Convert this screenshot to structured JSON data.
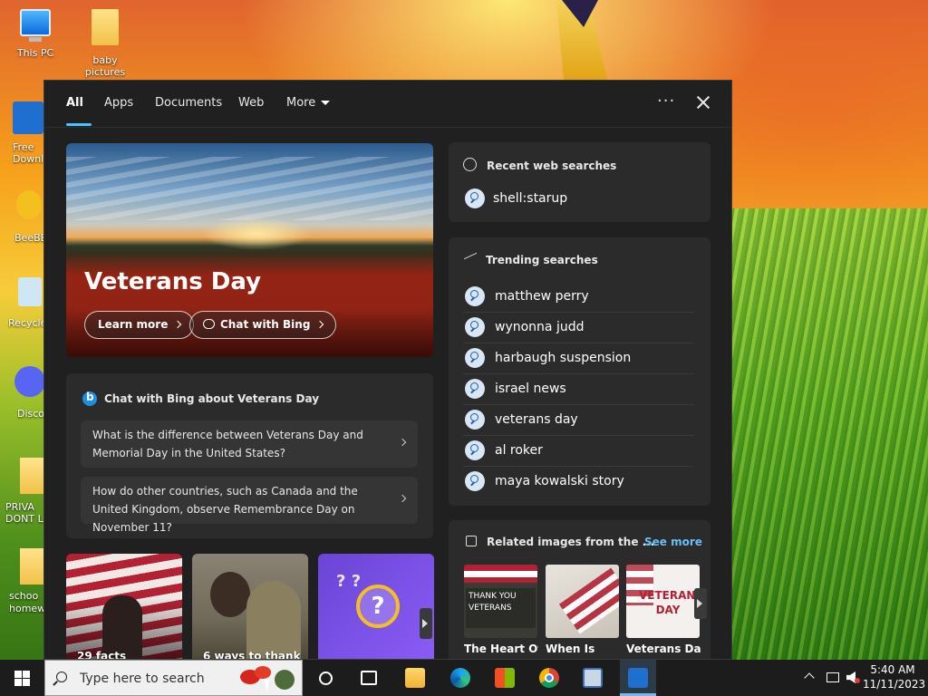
{
  "desktop": {
    "icons": [
      {
        "label": "This PC"
      },
      {
        "label": "baby pictures"
      },
      {
        "label": "Free Downl"
      },
      {
        "label": "BeeBE"
      },
      {
        "label": "Recycle"
      },
      {
        "label": "Disco"
      },
      {
        "label": "PRIVA DONT L"
      },
      {
        "label": "schoo homew"
      }
    ]
  },
  "search_panel": {
    "tabs": [
      {
        "label": "All",
        "active": true
      },
      {
        "label": "Apps"
      },
      {
        "label": "Documents"
      },
      {
        "label": "Web"
      },
      {
        "label": "More"
      }
    ],
    "more_icon": "ellipsis-icon",
    "close_icon": "close-icon",
    "hero": {
      "title": "Veterans Day",
      "learn_more": "Learn more",
      "chat_with_bing": "Chat with Bing"
    },
    "bing_chat": {
      "heading": "Chat with Bing about Veterans Day",
      "questions": [
        "What is the difference between Veterans Day and Memorial Day in the United States?",
        "How do other countries, such as Canada and the United Kingdom, observe Remembrance Day on November 11?"
      ]
    },
    "thumbnails": [
      {
        "label": "29 facts"
      },
      {
        "label": "6 ways to thank"
      },
      {
        "label": ""
      }
    ],
    "recent": {
      "heading": "Recent web searches",
      "items": [
        "shell:starup"
      ]
    },
    "trending": {
      "heading": "Trending searches",
      "items": [
        "matthew perry",
        "wynonna judd",
        "harbaugh suspension",
        "israel news",
        "veterans day",
        "al roker",
        "maya kowalski story"
      ]
    },
    "related": {
      "heading": "Related images from the ...",
      "see_more": "See more",
      "images": [
        {
          "label": "The Heart Of",
          "text": "THANK YOU VETERANS"
        },
        {
          "label": "When Is",
          "text": ""
        },
        {
          "label": "Veterans Day",
          "text": "VETERANS DAY"
        }
      ]
    }
  },
  "taskbar": {
    "search_placeholder": "Type here to search",
    "apps": [
      "file-explorer-icon",
      "edge-icon",
      "store-icon",
      "chrome-icon",
      "app-icon",
      "freedownload-icon"
    ],
    "clock": {
      "time": "5:40 AM",
      "date": "11/11/2023"
    },
    "accent": "#4cc2ff"
  }
}
